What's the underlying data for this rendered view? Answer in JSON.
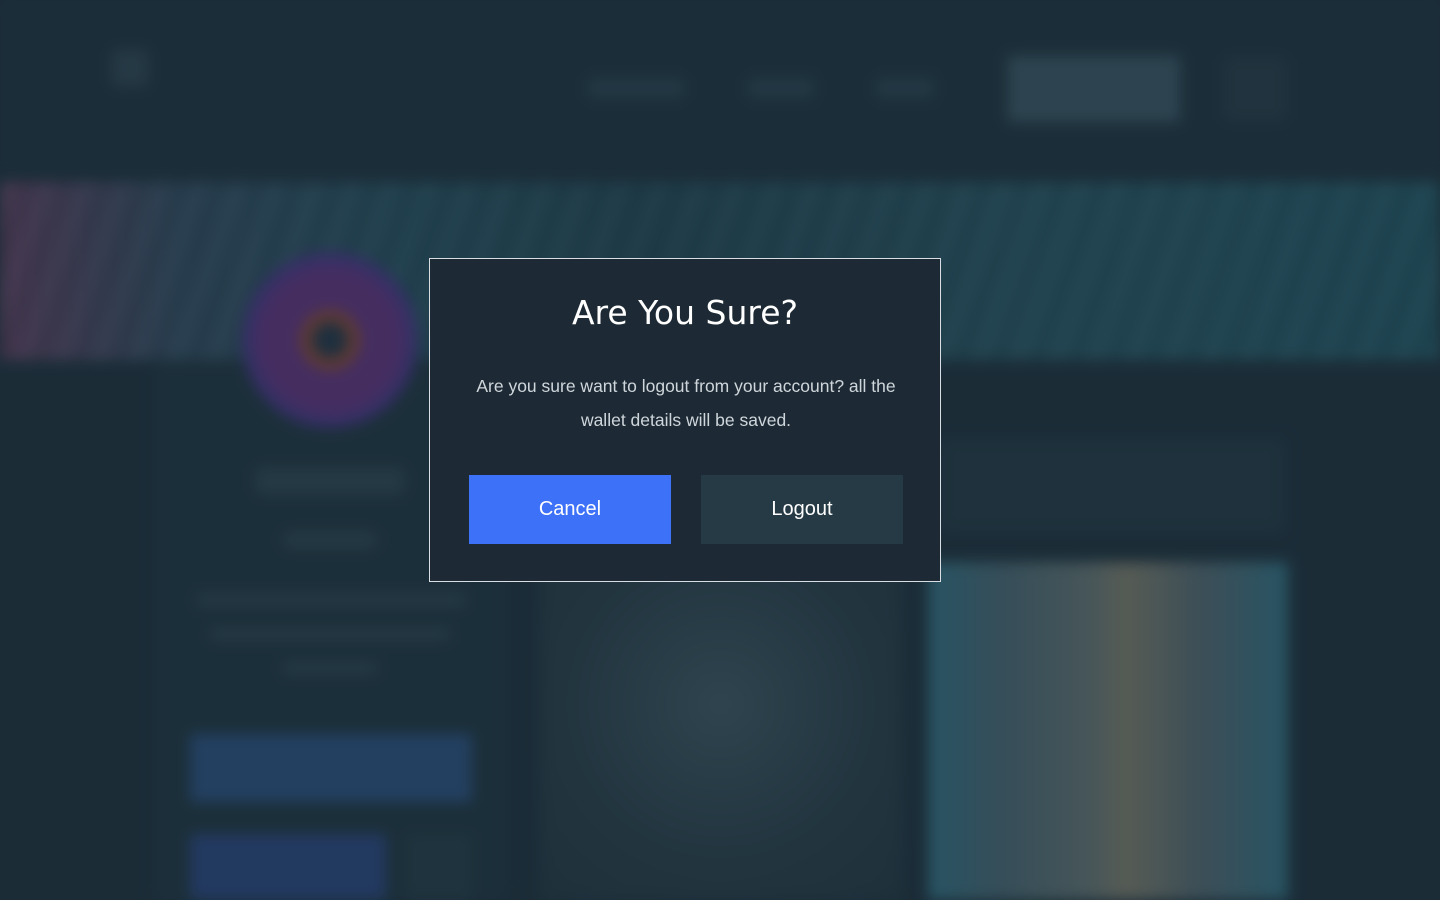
{
  "dialog": {
    "title": "Are You Sure?",
    "message": "Are you sure want to logout from your account? all the wallet details will be saved.",
    "cancel_label": "Cancel",
    "logout_label": "Logout"
  },
  "colors": {
    "primary_button": "#3c71f8",
    "secondary_button": "#253a45",
    "dialog_background": "#1d2a35",
    "page_background": "#243844"
  }
}
